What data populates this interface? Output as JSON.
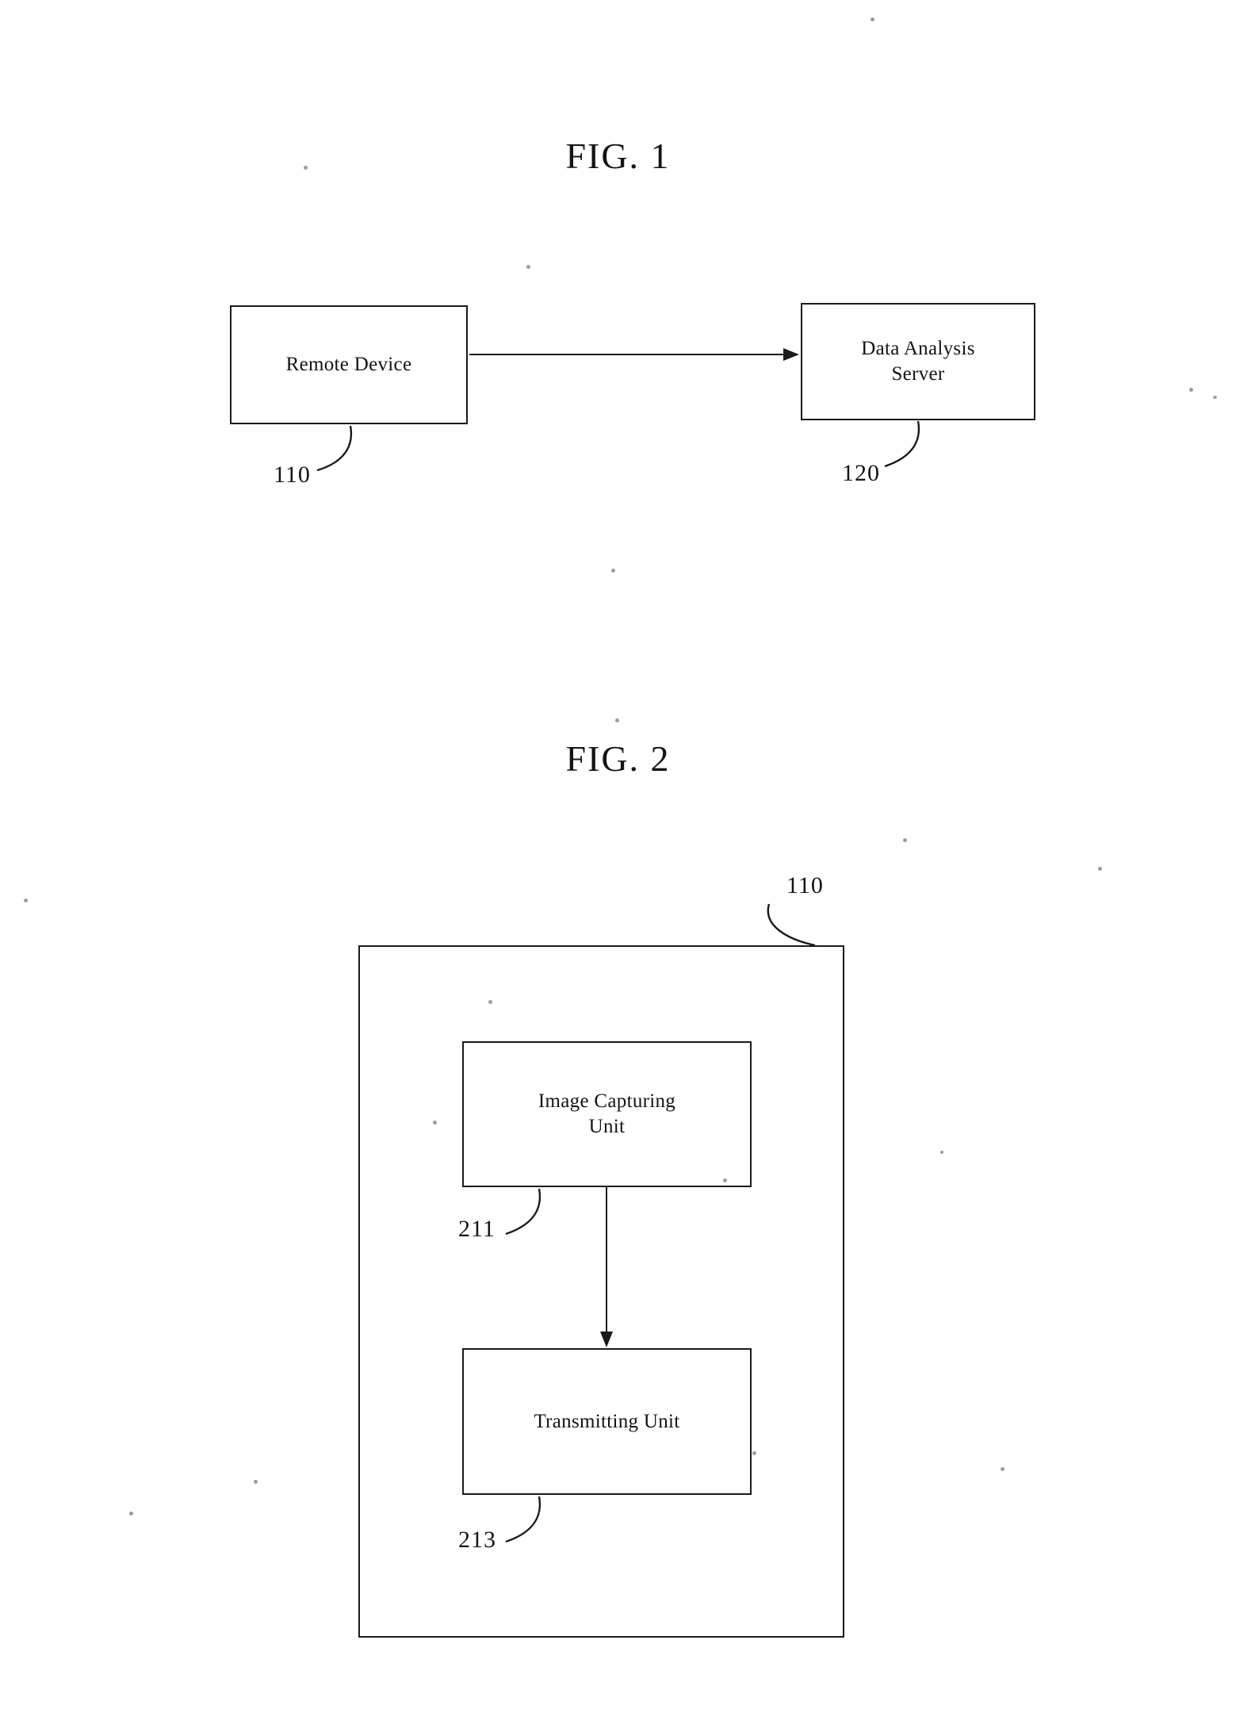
{
  "document": {
    "kind": "patent-drawing-sheet",
    "background_color": "#ffffff",
    "ink_color": "#1a1a1a"
  },
  "figures": [
    {
      "id": "fig-1",
      "title": "FIG. 1",
      "nodes": [
        {
          "id": "remote-device",
          "label": "Remote Device",
          "ref": "110"
        },
        {
          "id": "data-analysis-server",
          "label": "Data Analysis\nServer",
          "ref": "120"
        }
      ],
      "edges": [
        {
          "from": "remote-device",
          "to": "data-analysis-server",
          "style": "solid-arrow",
          "direction": "right"
        }
      ]
    },
    {
      "id": "fig-2",
      "title": "FIG. 2",
      "container": {
        "id": "remote-device-detail",
        "ref": "110"
      },
      "nodes": [
        {
          "id": "image-capturing-unit",
          "label": "Image Capturing\nUnit",
          "ref": "211"
        },
        {
          "id": "transmitting-unit",
          "label": "Transmitting Unit",
          "ref": "213"
        }
      ],
      "edges": [
        {
          "from": "image-capturing-unit",
          "to": "transmitting-unit",
          "style": "solid-arrow",
          "direction": "down"
        }
      ]
    }
  ],
  "fig1": {
    "title": "FIG. 1",
    "remote_device": {
      "label": "Remote Device",
      "ref": "110"
    },
    "data_analysis_server": {
      "label": "Data Analysis\nServer",
      "ref": "120"
    }
  },
  "fig2": {
    "title": "FIG. 2",
    "outer": {
      "ref": "110"
    },
    "image_capturing_unit": {
      "label": "Image Capturing\nUnit",
      "ref": "211"
    },
    "transmitting_unit": {
      "label": "Transmitting Unit",
      "ref": "213"
    }
  }
}
